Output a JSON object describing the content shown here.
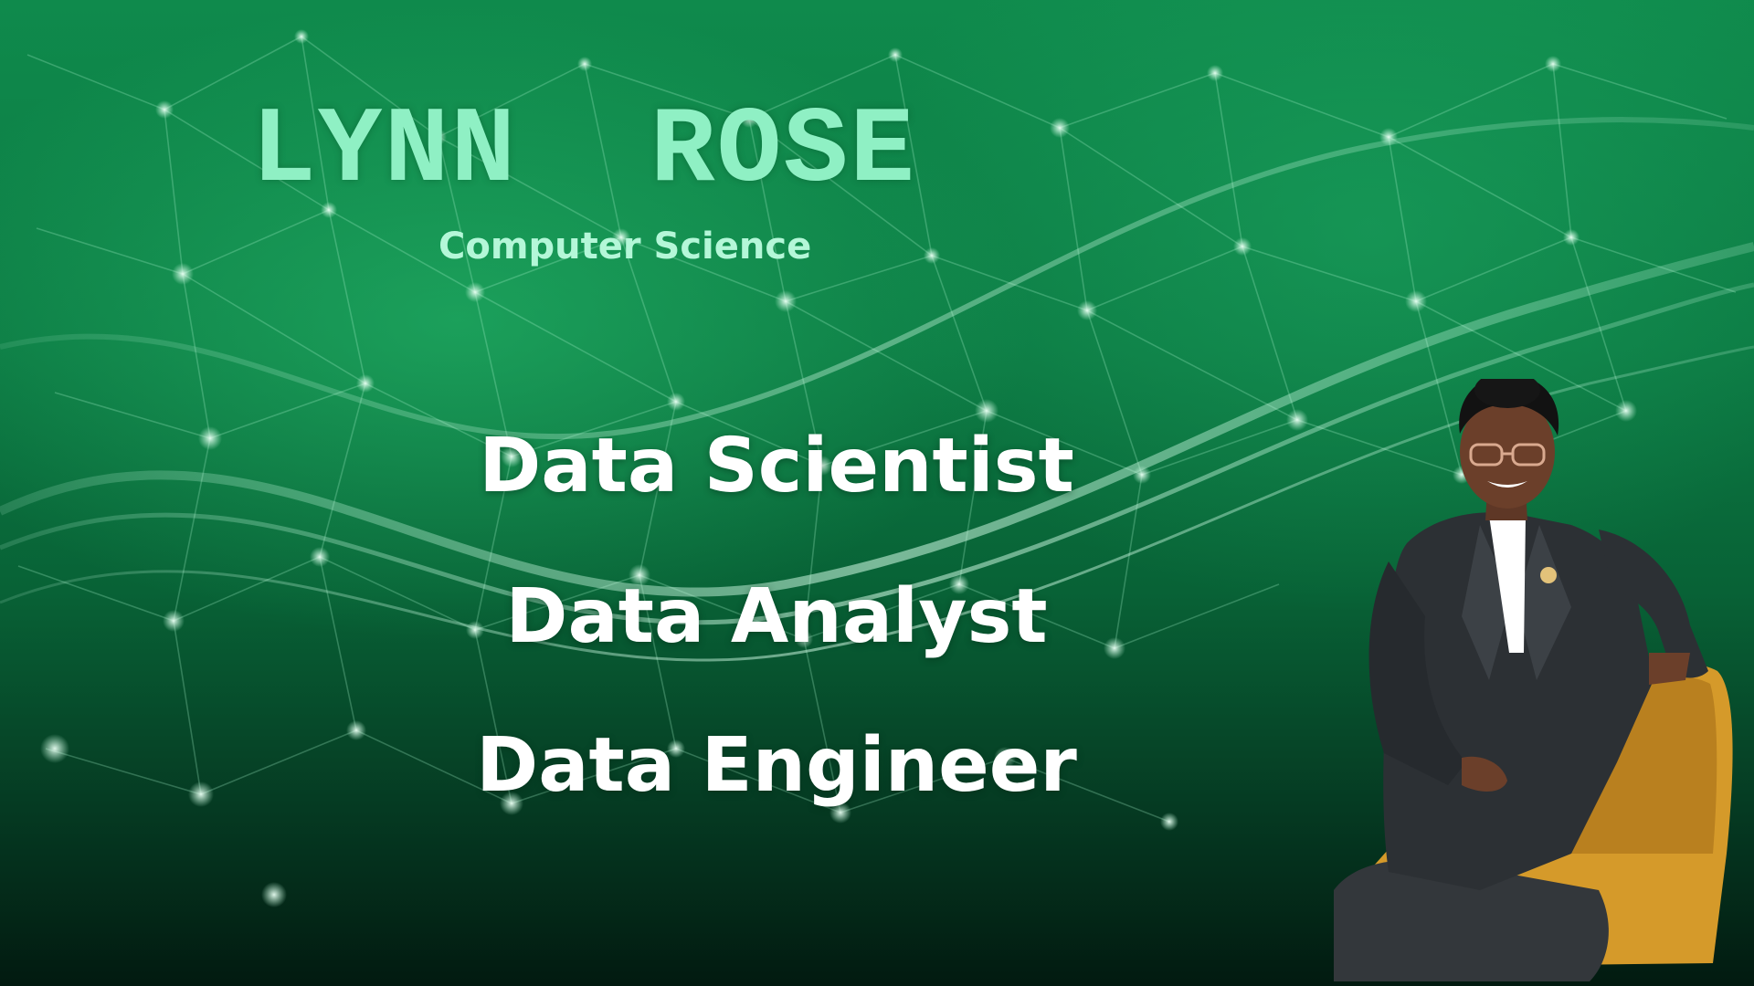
{
  "banner": {
    "name": "LYNN  ROSE",
    "subtitle": "Computer Science",
    "roles": [
      {
        "label": "Data Scientist"
      },
      {
        "label": "Data Analyst"
      },
      {
        "label": "Data Engineer"
      }
    ]
  },
  "portrait": {
    "icon": "person-photo",
    "description_colors": {
      "jacket": "#2c3034",
      "chair": "#d59a2a",
      "shirt": "#ffffff"
    }
  },
  "colors": {
    "background_green": "#0c7a43",
    "name_mint": "#8ff0c4",
    "subtitle_mint": "#b4f7d8",
    "roles_white": "#ffffff"
  }
}
